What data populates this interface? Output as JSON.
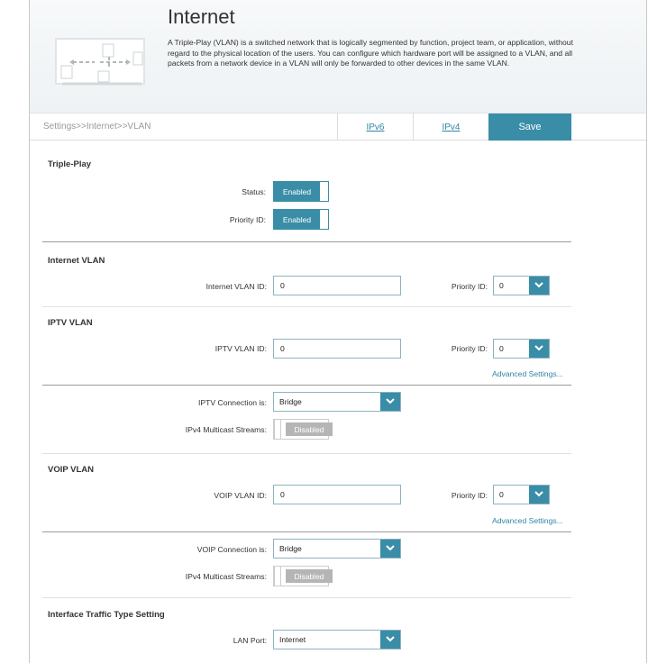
{
  "header": {
    "title": "Internet",
    "description": "A Triple-Play (VLAN) is a switched network that is logically segmented by function, project team, or application, without regard to the physical location of the users. You can configure which hardware port will be assigned to a VLAN, and all packets from a network device in a VLAN will only be forwarded to other devices in the same VLAN."
  },
  "nav": {
    "breadcrumb": "Settings>>Internet>>VLAN",
    "tabs": [
      {
        "label": "IPv6"
      },
      {
        "label": "IPv4"
      }
    ],
    "save_label": "Save"
  },
  "triple_play": {
    "title": "Triple-Play",
    "status_label": "Status:",
    "status_value": "Enabled",
    "priority_label": "Priority ID:",
    "priority_value": "Enabled"
  },
  "internet_vlan": {
    "title": "Internet VLAN",
    "id_label": "Internet VLAN ID:",
    "id_value": "0",
    "priority_label": "Priority ID:",
    "priority_value": "0"
  },
  "iptv_vlan": {
    "title": "IPTV VLAN",
    "id_label": "IPTV VLAN ID:",
    "id_value": "0",
    "priority_label": "Priority ID:",
    "priority_value": "0",
    "advanced_label": "Advanced Settings...",
    "connection_label": "IPTV Connection is:",
    "connection_value": "Bridge",
    "multicast_label": "IPv4 Multicast Streams:",
    "multicast_value": "Disabled"
  },
  "voip_vlan": {
    "title": "VOIP VLAN",
    "id_label": "VOIP VLAN ID:",
    "id_value": "0",
    "priority_label": "Priority ID:",
    "priority_value": "0",
    "advanced_label": "Advanced Settings...",
    "connection_label": "VOIP Connection is:",
    "connection_value": "Bridge",
    "multicast_label": "IPv4 Multicast Streams:",
    "multicast_value": "Disabled"
  },
  "interface_traffic": {
    "title": "Interface Traffic Type Setting",
    "lan_port_label": "LAN Port:",
    "lan_port_value": "Internet"
  },
  "colors": {
    "accent": "#3a8da7",
    "link": "#2f86a7",
    "disabled": "#b5b5b5"
  }
}
